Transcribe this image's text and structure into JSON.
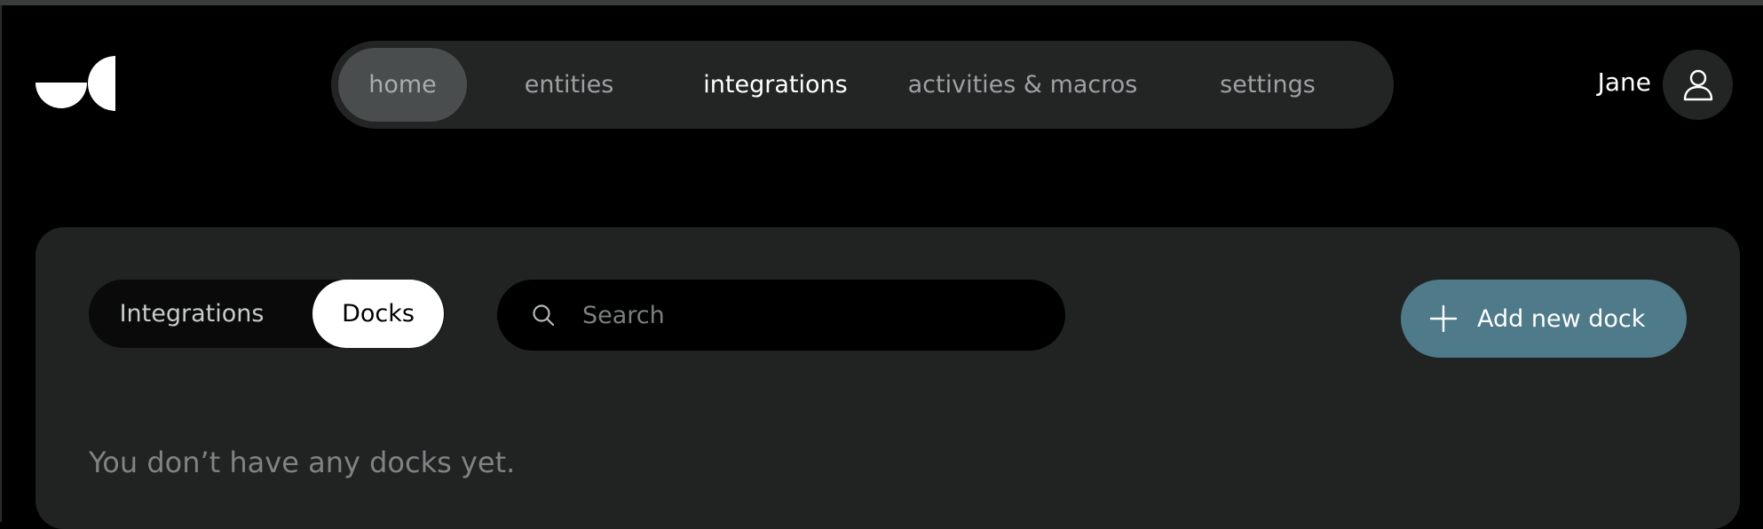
{
  "header": {
    "nav": [
      {
        "label": "home"
      },
      {
        "label": "entities"
      },
      {
        "label": "integrations"
      },
      {
        "label": "activities & macros"
      },
      {
        "label": "settings"
      }
    ],
    "user": {
      "name": "Jane",
      "avatar_icon": "user-icon"
    }
  },
  "panel": {
    "toggle": {
      "options": [
        "Integrations",
        "Docks"
      ],
      "selected": "Docks"
    },
    "search": {
      "placeholder": "Search",
      "value": "",
      "icon": "search-icon"
    },
    "add_button": {
      "label": "Add new dock",
      "icon": "plus-icon"
    },
    "empty_message": "You don’t have any docks yet."
  },
  "colors": {
    "background": "#000000",
    "panel": "#212323",
    "nav_bg": "#232525",
    "nav_active": "#4a4d4d",
    "accent": "#4f7a8a"
  }
}
